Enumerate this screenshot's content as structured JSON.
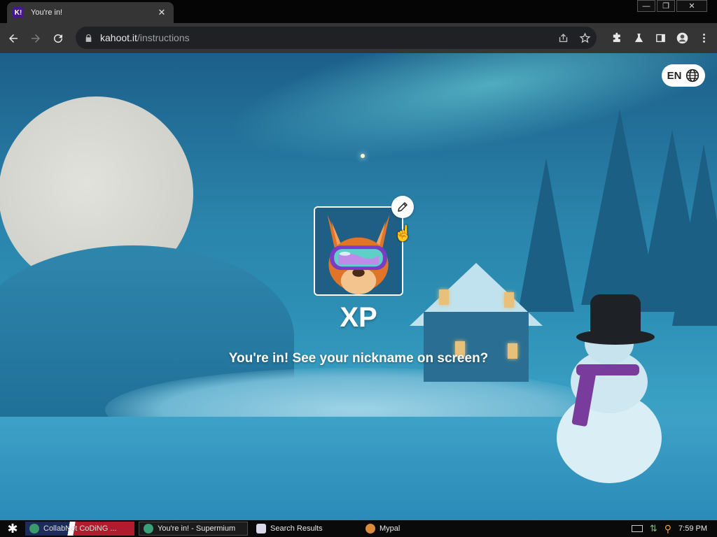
{
  "browser": {
    "tab_title": "You're in!",
    "favicon_text": "K!",
    "url_host": "kahoot.it",
    "url_path": "/instructions",
    "window_buttons": [
      "—",
      "❐",
      "✕"
    ]
  },
  "page": {
    "language_label": "EN",
    "nickname": "XP",
    "message": "You're in! See your nickname on screen?"
  },
  "taskbar": {
    "items": [
      {
        "label": "CollabNet CoDiNG ..."
      },
      {
        "label": "You're in! - Supermium"
      },
      {
        "label": "Search Results"
      },
      {
        "label": "Mypal"
      }
    ],
    "clock": "7:59 PM"
  },
  "colors": {
    "kahoot_purple": "#46178f",
    "sky": "#2a83aa",
    "chrome_dark": "#353535"
  },
  "icons": [
    "back-icon",
    "forward-icon",
    "reload-icon",
    "lock-icon",
    "share-icon",
    "star-icon",
    "extensions-icon",
    "labs-icon",
    "sidepanel-icon",
    "profile-icon",
    "menu-icon",
    "globe-icon",
    "pencil-icon"
  ]
}
